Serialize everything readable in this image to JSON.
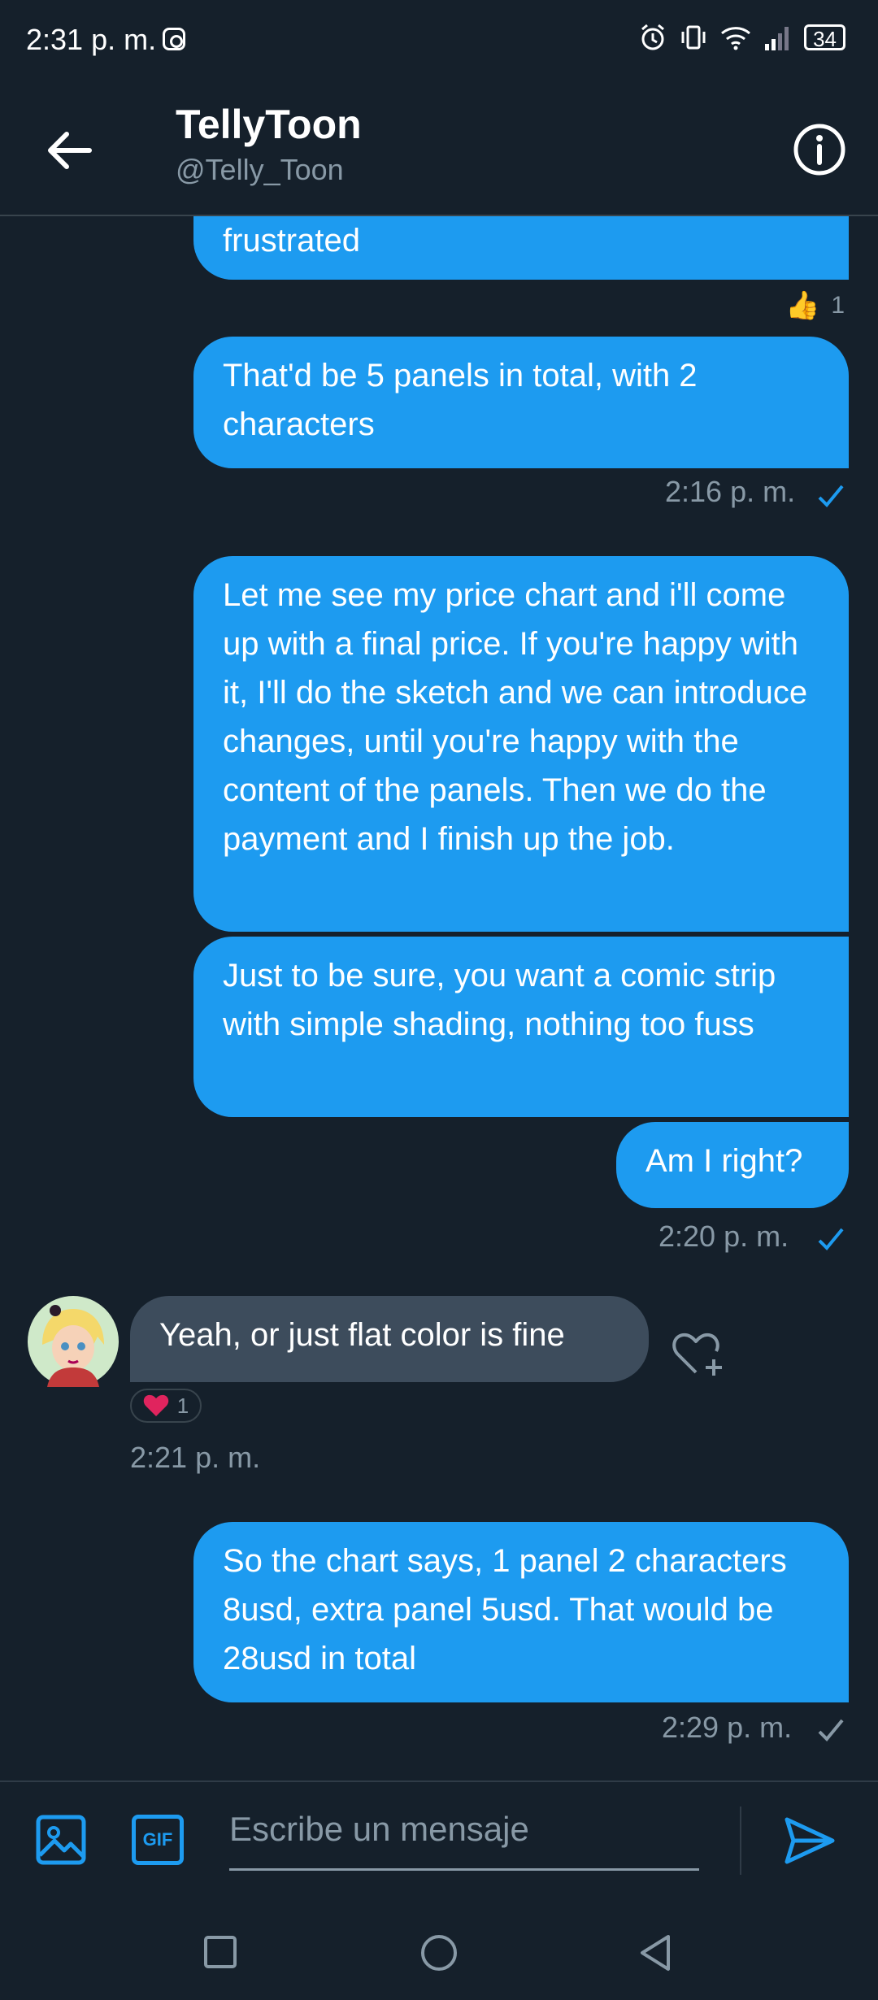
{
  "status_bar": {
    "time": "2:31 p. m.",
    "battery": "34"
  },
  "header": {
    "title": "TellyToon",
    "handle": "@Telly_Toon"
  },
  "messages": {
    "m0": "frustrated",
    "reaction0_count": "1",
    "m1": "That'd be 5 panels in total, with 2 characters",
    "ts1": "2:16 p. m.",
    "m2": "Let me see my price chart and i'll come up with a final price. If you're happy with it, I'll do the sketch and we can introduce changes, until you're happy with the content of the panels. Then we do the payment and I finish up the job.",
    "m3": "Just to be sure, you want a comic strip with simple shading, nothing too fuss",
    "m4": "Am I right?",
    "ts4": "2:20 p. m.",
    "in1": "Yeah, or just flat color is fine",
    "reaction_in1_count": "1",
    "ts_in1": "2:21 p. m.",
    "m5": "So the chart says, 1 panel 2 characters 8usd, extra panel 5usd. That would be 28usd in total",
    "ts5": "2:29 p. m."
  },
  "composer": {
    "placeholder": "Escribe un mensaje",
    "gif_label": "GIF"
  },
  "colors": {
    "accent": "#1d9bf0",
    "background": "#15202b",
    "muted": "#8899a6",
    "incoming": "#3d4c5c",
    "heart": "#e0245e"
  }
}
